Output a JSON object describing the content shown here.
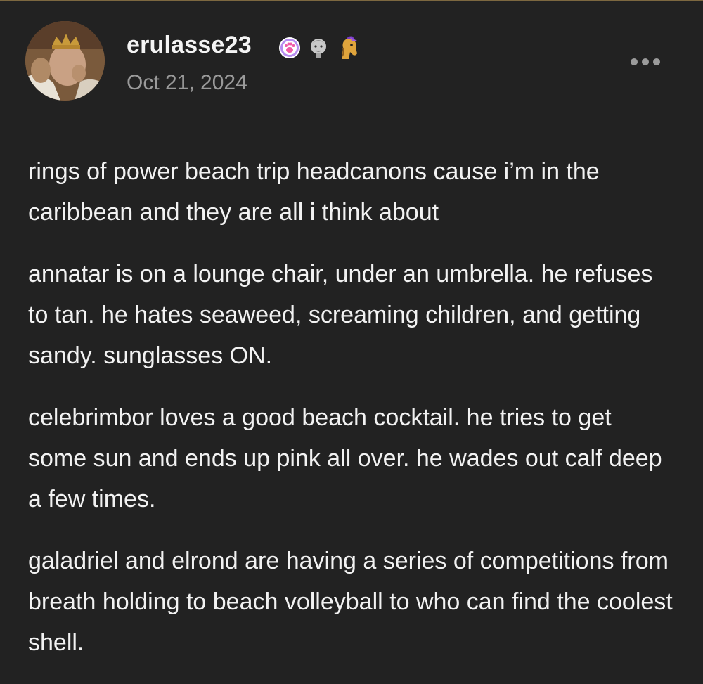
{
  "colors": {
    "background": "#222222",
    "text": "#f2f2f2",
    "muted": "#9a9a9a"
  },
  "post": {
    "author": "erulasse23",
    "date": "Oct 21, 2024",
    "badges": [
      "paw-badge-icon",
      "statue-head-badge-icon",
      "horse-badge-icon"
    ],
    "more_icon": "ellipsis-icon",
    "paragraphs": [
      "rings of power beach trip headcanons cause i’m in the caribbean and they are all i think about",
      "annatar is on a lounge chair, under an umbrella. he refuses to tan. he hates seaweed, screaming children, and getting sandy. sunglasses ON.",
      "celebrimbor loves a good beach cocktail. he tries to get some sun and ends up pink all over. he wades out calf deep a few times.",
      "galadriel and elrond are having a series of competitions from breath holding to beach volleyball to who can find the coolest shell."
    ]
  }
}
